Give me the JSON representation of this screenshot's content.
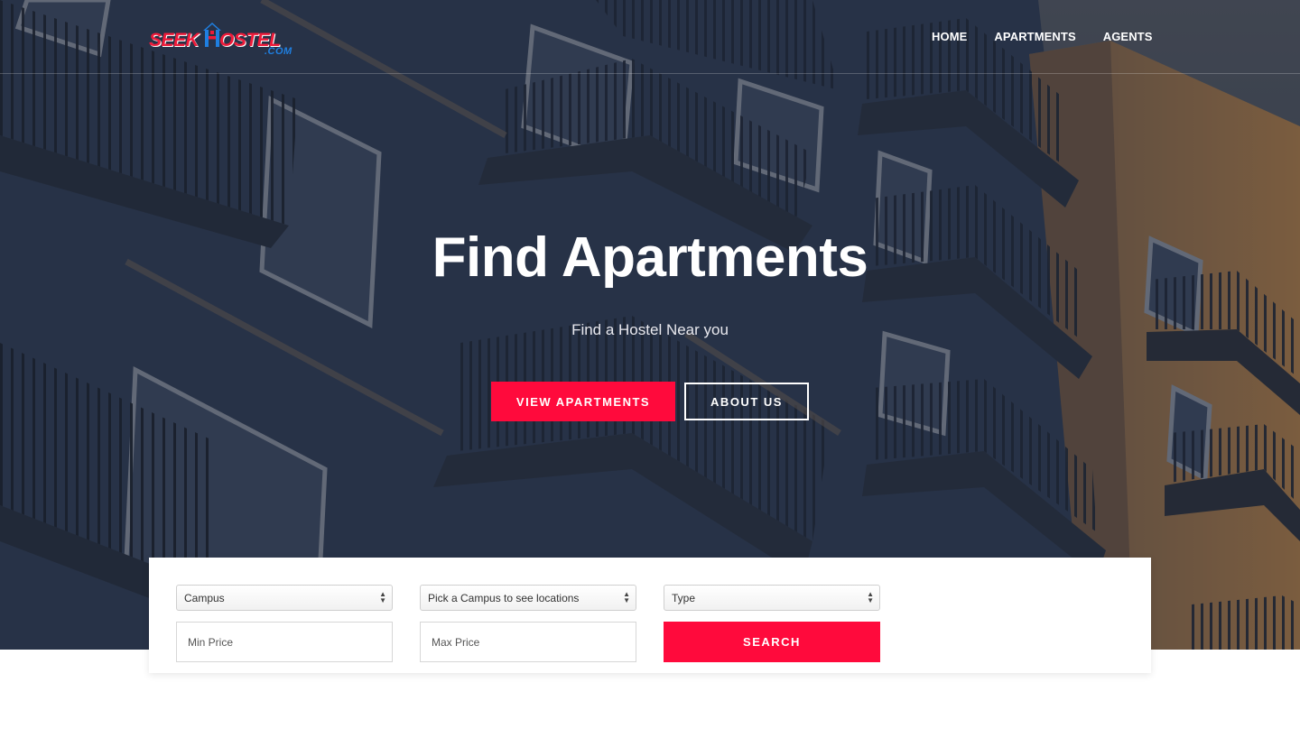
{
  "brand": {
    "word1": "SEEK",
    "word2": "OSTEL",
    "suffix": ".COM"
  },
  "nav": {
    "items": [
      "Home",
      "Apartments",
      "Agents"
    ]
  },
  "hero": {
    "title": "Find Apartments",
    "subtitle": "Find a Hostel Near you",
    "primary_button": "VIEW APARTMENTS",
    "secondary_button": "ABOUT US"
  },
  "search": {
    "campus_select": "Campus",
    "location_select": "Pick a Campus to see locations",
    "type_select": "Type",
    "min_price_placeholder": "Min Price",
    "max_price_placeholder": "Max Price",
    "search_button": "SEARCH"
  },
  "colors": {
    "accent": "#ff0a3c",
    "logo_red": "#ee1b3a",
    "logo_blue": "#1f7fe0"
  }
}
